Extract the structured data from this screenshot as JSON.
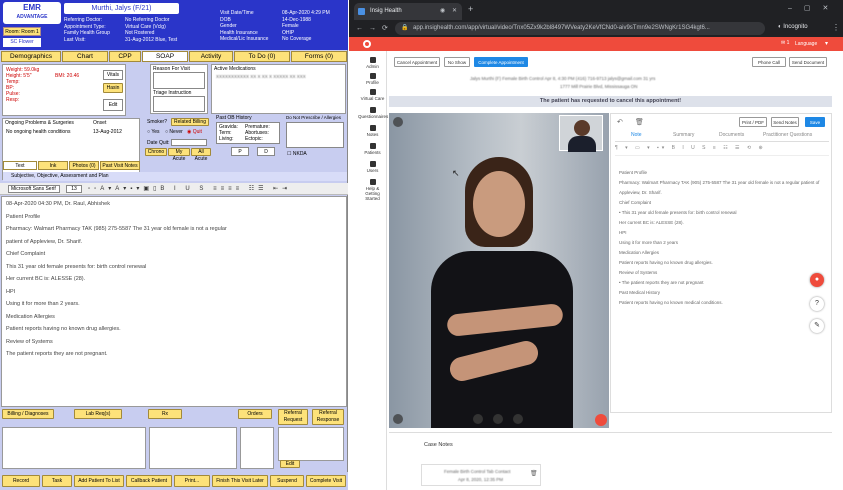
{
  "emr": {
    "logo_line1": "EMR",
    "logo_line2": "ADVANTAGE",
    "room": "Room: Room 1",
    "arrived": "SC Flower",
    "patient_name": "Murthi, Jalys (F/21)",
    "header_left": [
      "Referring Doctor:",
      "Appointment Type:",
      "Family Health Group",
      "Last Visit:"
    ],
    "header_mid": [
      "No Referring Doctor",
      "Virtual Care (Vclg)",
      "Not Rostered",
      "31-Aug-2012 Blue, Test"
    ],
    "header_right_labels": [
      "Visit Date/Time",
      "DOB",
      "Gender",
      "Health Insurance",
      "Medical/Lic Insurance"
    ],
    "header_right_values": [
      "08-Apr-2020   4:29 PM",
      "14-Dec-1988",
      "Female",
      "OHIP",
      "No Coverage"
    ],
    "tabs": [
      "Demographics",
      "Chart",
      "CPP",
      "SOAP",
      "Activity",
      "To Do (0)",
      "Forms (0)"
    ],
    "vitals": [
      "Weight: 59.0kg",
      "Height: 5'5\"",
      "Temp:",
      "BP:",
      "Pulse:",
      "Resp:",
      "BMI: 20.46"
    ],
    "vitals_btns": [
      "Vitals",
      "Hasin",
      "Edit"
    ],
    "reason_label": "Reason For Visit",
    "triage_label": "Triage Instruction",
    "meds_label": "Active Medications",
    "meds_text": "XXXXXXXXXXX XX X XX X XXXXX XX XXX",
    "ongoing_label": "Ongoing Problems & Surgeries",
    "onset_label": "Onset",
    "ongoing_value": "No ongoing health conditions",
    "onset_value": "13-Aug-2012",
    "smoker_label": "Smoker?",
    "related_billing": "Related Billing",
    "smoker_opts": [
      "Yes",
      "Never",
      "Quit"
    ],
    "date_quit": "Date Quit:",
    "chrono_btns": [
      "Chrono",
      "My Acute",
      "All Acute"
    ],
    "ob_label": "Past OB History",
    "ob_left": [
      "Gravida:",
      "Term:",
      "Living:"
    ],
    "ob_right": [
      "Premature:",
      "Abortuses:",
      "Ectopic:"
    ],
    "ob_btns": [
      "P",
      "D"
    ],
    "dnp_label": "Do Not Prescribe / Allergies",
    "nkda": "NKDA",
    "note_tabs": [
      "Text",
      "Ink",
      "Photos (0)",
      "Past Visit Notes"
    ],
    "note_subtitle": "Subjective, Objective, Assessment and Plan",
    "font_name": "Microsoft Sans Serif",
    "font_size": "13",
    "note_lines": [
      "08-Apr-2020 04:30 PM, Dr. Raul, Abhishek",
      "Patient Profile",
      "Pharmacy: Walmart Pharmacy TAK (985) 275-5587 The 31 year old female is not a regular",
      "patient of Appleview, Dr. Sharif.",
      "Chief Complaint",
      "This 31 year old female presents for: birth control renewal",
      "Her current BC is: ALESSE (28).",
      "HPI",
      "Using it for more than 2 years.",
      "Medication Allergies",
      "Patient reports having no known drug allergies.",
      "Review of Systems",
      "The patient reports they are not pregnant."
    ],
    "bill_btns": [
      "Billing / Diagnoses",
      "Lab Req(s)",
      "Rx",
      "Orders",
      "Referral Request",
      "Referral Response"
    ],
    "edit_btn": "Edit",
    "bottom_btns": [
      "Record",
      "Task",
      "Add Patient To List",
      "Callback Patient",
      "Print...",
      "Finish This Visit Later",
      "Suspend",
      "Complete Visit"
    ]
  },
  "browser": {
    "tab_title": "Insig Health",
    "url": "app.insighealth.com/app/virtual/video/Tnx05Zx9k2bl8497WVeaty2KeVfCNd0-aiv9sTmn9e2SWNgKr1SG4kgt6...",
    "incognito": "Incognito",
    "plus": "+",
    "msg_count": "1",
    "language": "Language",
    "side_items": [
      "Admin",
      "Profile",
      "Virtual Care",
      "Questionnaires",
      "Notes",
      "Patients",
      "Users",
      "Help & Getting Started"
    ],
    "top_btns": [
      "Cancel Appointment",
      "No Show",
      "Complete Appointment"
    ],
    "right_btns": [
      "Phone Call",
      "Send Document"
    ],
    "patient_row": "Jalys Murthi (F) Female   Birth Control   Apr 8, 4:30 PM   (416) 716-9713   jalys@gmail.com   31 yrs",
    "address_row": "1777 Mill Prairie Blvd, Mississauga ON",
    "banner": "The patient has requested to cancel this appointment!",
    "panel_tabs": [
      "Note",
      "Summary",
      "Documents",
      "Practitioner Questions"
    ],
    "panel_btns": [
      "Print / PDF",
      "Send Notes",
      "Save"
    ],
    "panel_lines": [
      "Patient Profile",
      "Pharmacy: Walmart Pharmacy TAK (905) 275-5587 The 31 year old female is not a regular patient of",
      "Appleview, Dr. Sharif.",
      "Chief Complaint",
      "• This 31 year old female presents for: birth control renewal",
      "Her current BC is: ALESSE (28).",
      "HPI",
      "Using it for more than 2 years",
      "Medication Allergies",
      "Patient reports having no known drug allergies.",
      "Review of Systems",
      "• The patient reports they are not pregnant",
      "Past Medical History",
      "Patient reports having no known medical conditions."
    ],
    "case_notes": "Case Notes",
    "case_item": "Female Birth Control Tab Contact",
    "case_date": "Apr 8, 2020, 12:35 PM"
  },
  "colors": {
    "emr_blue": "#2a35c9",
    "emr_yellow": "#fde27a",
    "insig_red": "#ef4b3c",
    "insig_blue": "#1e88e5"
  }
}
